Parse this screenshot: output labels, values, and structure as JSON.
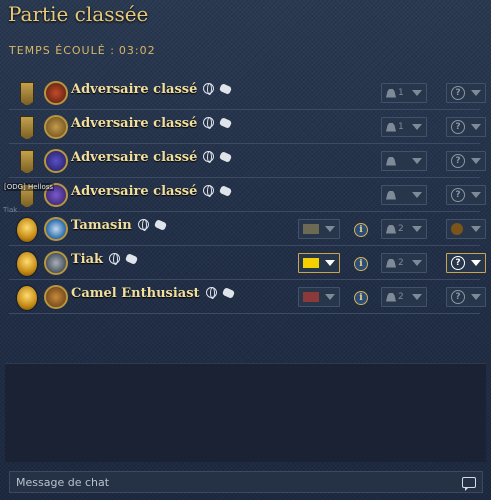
{
  "header": {
    "title": "Partie classée",
    "timer_label": "TEMPS ÉCOULÉ :",
    "timer_value": "03:02"
  },
  "tooltip": {
    "text": "[ODG] Helloss",
    "sub": "Tiak"
  },
  "players": [
    {
      "name": "Adversaire classé",
      "team": "1",
      "role": "?",
      "is_self": false,
      "has_civ": false,
      "rank": "banner",
      "avatar": "a1"
    },
    {
      "name": "Adversaire classé",
      "team": "1",
      "role": "?",
      "is_self": false,
      "has_civ": false,
      "rank": "banner",
      "avatar": "a2"
    },
    {
      "name": "Adversaire classé",
      "team": "",
      "role": "?",
      "is_self": false,
      "has_civ": false,
      "rank": "banner",
      "avatar": "a3"
    },
    {
      "name": "Adversaire classé",
      "team": "",
      "role": "?",
      "is_self": false,
      "has_civ": false,
      "rank": "banner",
      "avatar": "a4"
    },
    {
      "name": "Tamasin",
      "team": "2",
      "role": "",
      "is_self": false,
      "has_civ": true,
      "civ_color": "#6d6a53",
      "rank": "gold",
      "avatar": "a5"
    },
    {
      "name": "Tiak",
      "team": "2",
      "role": "?",
      "is_self": true,
      "has_civ": true,
      "civ_color": "#f5d000",
      "rank": "gold",
      "avatar": "a6"
    },
    {
      "name": "Camel Enthusiast",
      "team": "2",
      "role": "?",
      "is_self": false,
      "has_civ": true,
      "civ_color": "#8a3a3a",
      "rank": "gold",
      "avatar": "a7"
    }
  ],
  "chat": {
    "placeholder": "Message de chat"
  },
  "colors": {
    "accent": "#e8c97a",
    "highlight": "#c9a64a"
  }
}
